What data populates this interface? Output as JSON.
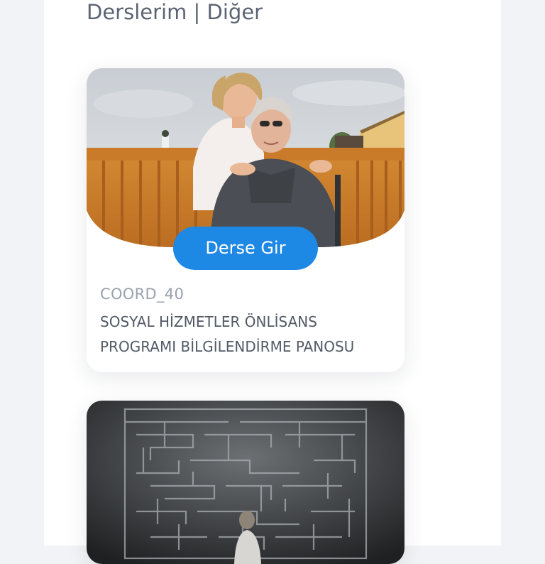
{
  "page": {
    "title": "Derslerim | Diğer"
  },
  "courses": [
    {
      "code": "COORD_40",
      "name": "SOSYAL HİZMETLER ÖNLİSANS\nPROGRAMI BİLGİLENDİRME PANOSU",
      "button_label": "Derse Gir",
      "image": "caregiver-with-elderly-woman"
    },
    {
      "image": "person-facing-maze-wall"
    }
  ],
  "colors": {
    "background": "#f2f3f6",
    "card": "#ffffff",
    "title": "#5b6374",
    "button": "#1e88e5",
    "code": "#9aa2ad",
    "course_name": "#525a66"
  }
}
